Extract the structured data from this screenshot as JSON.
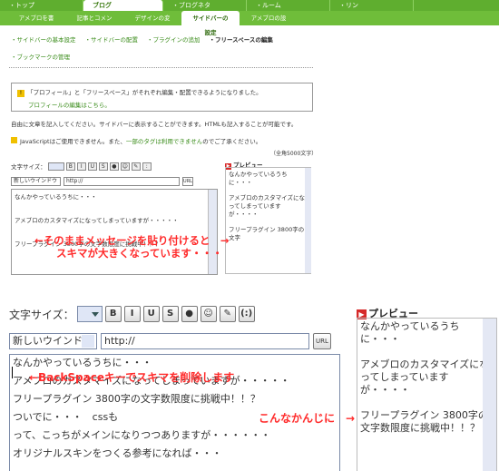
{
  "nav": {
    "tabs": [
      "・トップ",
      "ブログ",
      "・ブログネタ",
      "・ルーム",
      "・リン"
    ]
  },
  "subnav": {
    "items": [
      "アメブロを書く",
      "記事とコメント",
      "デザインの変更",
      "サイドバーの設定",
      "アメブロの設定"
    ]
  },
  "breadcrumb": {
    "items": [
      "・サイドバーの基本設定",
      "・サイドバーの配置",
      "・プラグインの追加",
      "・フリースペースの編集"
    ],
    "row2": "・ブックマークの管理"
  },
  "notice": {
    "icon": "!",
    "text": "「プロフィール」と「フリースペース」がそれぞれ編集・配置できるようになりました。",
    "link": "プロフィールの編集はこちら。"
  },
  "para1": "自由に文章を記入してください。サイドバーに表示することができます。HTMLも記入することが可能です。",
  "para2_pre": "JavaScriptはご使用できません。また、",
  "para2_link": "一部のタグは利用できません",
  "para2_post": "のでご了承ください。",
  "maxchars": "（全角5000文字）",
  "editor_small": {
    "font_size_label": "文字サイズ：",
    "window_select": "新しいウインドウ",
    "url_value": "http://",
    "url_button": "URL",
    "lines": [
      "なんかやっているうちに・・・",
      "アメブロのカスタマイズになってしまっていますが・・・・・",
      "フリープラグイン 3800字の文字数限度に挑戦中！！？"
    ]
  },
  "preview_small": {
    "title": "プレビュー",
    "lines": [
      "なんかやっているうちに・・・",
      "アメブロのカスタマイズになってしまっていますが・・・・",
      "フリープラグイン 3800字の文字"
    ]
  },
  "overlay1": {
    "line1": "←そのままメッセージを貼り付けると　→",
    "line2": "スキマが大きくなっています・・・"
  },
  "editor_large": {
    "font_size_label": "文字サイズ：",
    "buttons": [
      "B",
      "I",
      "U",
      "S",
      "●",
      "☺",
      "✎",
      "(:)"
    ],
    "window_select": "新しいウインドウ",
    "url_value": "http://",
    "url_button": "URL",
    "lines": [
      "なんかやっているうちに・・・",
      "アメブロのカスタマイズになってしまっていますが・・・・・",
      "フリープラグイン 3800字の文字数限度に挑戦中！！？",
      "ついでに・・・　cssも",
      "って、こっちがメインになりつつありますが・・・・・・",
      "オリジナルスキンをつくる参考になれば・・・"
    ]
  },
  "overlay2": "←BackSpaceキーでスキマを削除します",
  "overlay3": "こんなかんじに　→",
  "preview_large": {
    "title": "プレビュー",
    "lines": [
      "なんかやっているうちに・・・",
      "アメブロのカスタマイズになってしまっていますが・・・・",
      "フリープラグイン 3800字の文字数限度に挑戦中！！？"
    ]
  }
}
